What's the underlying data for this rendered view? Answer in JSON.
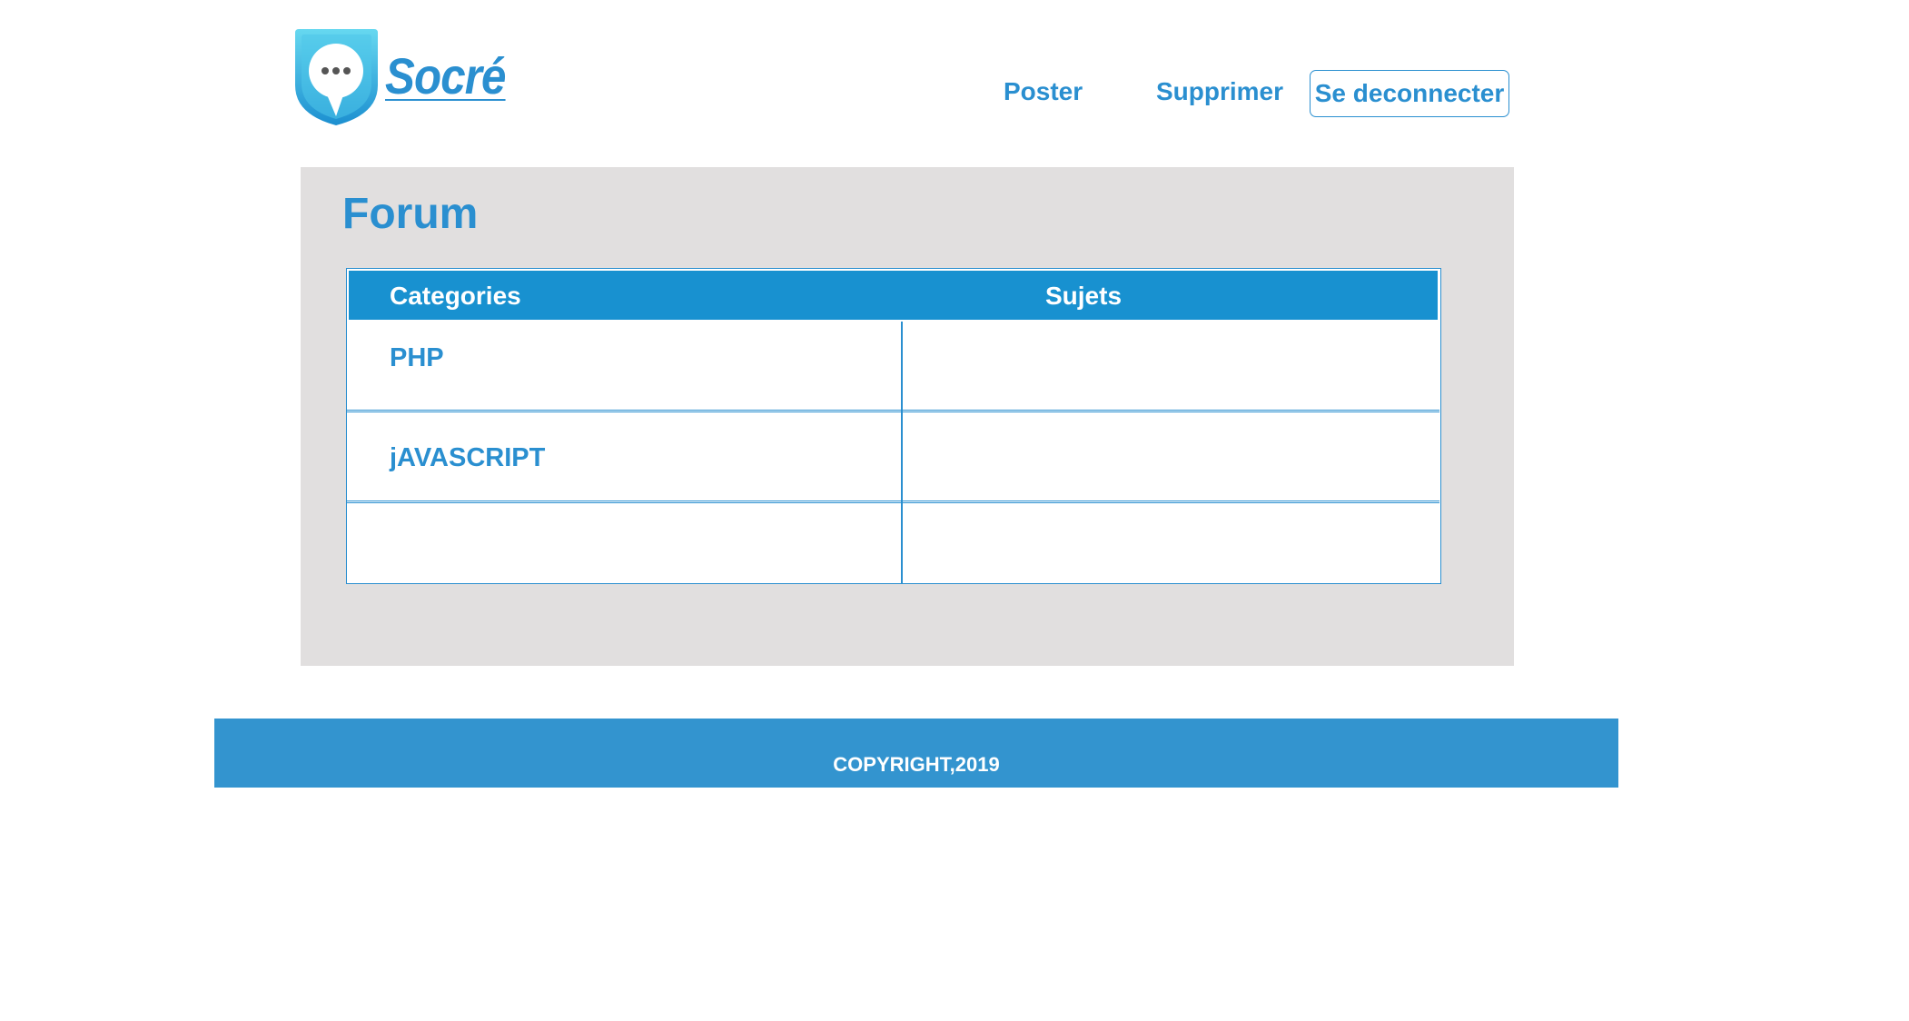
{
  "header": {
    "logo": {
      "text": "Socré",
      "icon": "speech-bubble-shield-icon",
      "colors": {
        "badge_light": "#5fd3ee",
        "badge_dark": "#1c8fd0",
        "text": "#2a8fd0"
      }
    },
    "nav": {
      "poster": "Poster",
      "supprimer": "Supprimer",
      "logout": "Se deconnecter"
    }
  },
  "main": {
    "title": "Forum",
    "table": {
      "headers": {
        "categories": "Categories",
        "sujets": "Sujets"
      },
      "rows": [
        {
          "category": "PHP",
          "subject": ""
        },
        {
          "category": "jAVASCRIPT",
          "subject": ""
        },
        {
          "category": "",
          "subject": ""
        }
      ]
    }
  },
  "footer": {
    "copyright": "COPYRIGHT,2019"
  },
  "colors": {
    "accent": "#2a8fd0",
    "table_header_bg": "#1891d0",
    "panel_bg": "#e1dfdf",
    "footer_bg": "#3394cf"
  }
}
